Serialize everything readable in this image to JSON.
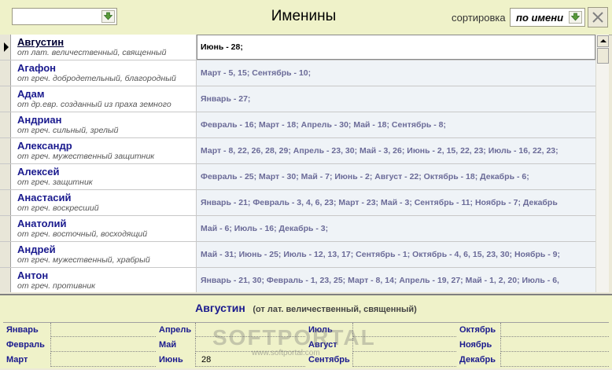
{
  "header": {
    "search_value": "",
    "title": "Именины",
    "sort_label": "сортировка",
    "sort_value": "по имени"
  },
  "rows": [
    {
      "name": "Августин",
      "origin": "от лат. величественный, священный",
      "dates": "Июнь - 28;",
      "selected": true
    },
    {
      "name": "Агафон",
      "origin": "от греч. добродетельный, благородный",
      "dates": "Март - 5, 15;   Сентябрь - 10;"
    },
    {
      "name": "Адам",
      "origin": "от др.евр. созданный из праха земного",
      "dates": "Январь - 27;"
    },
    {
      "name": "Андриан",
      "origin": "от греч. сильный, зрелый",
      "dates": "Февраль - 16;   Март - 18;   Апрель - 30;   Май - 18;   Сентябрь - 8;"
    },
    {
      "name": "Александр",
      "origin": "от греч. мужественный защитник",
      "dates": "Март - 8, 22, 26, 28, 29;   Апрель - 23, 30;   Май - 3, 26;   Июнь - 2, 15, 22, 23;   Июль - 16, 22, 23;"
    },
    {
      "name": "Алексей",
      "origin": "от греч. защитник",
      "dates": "Февраль - 25;   Март - 30;   Май - 7;   Июнь - 2;   Август - 22;   Октябрь - 18;   Декабрь - 6;"
    },
    {
      "name": "Анастасий",
      "origin": "от греч. воскресший",
      "dates": "Январь - 21;   Февраль - 3, 4, 6, 23;   Март - 23;   Май - 3;   Сентябрь - 11;   Ноябрь - 7;   Декабрь"
    },
    {
      "name": "Анатолий",
      "origin": "от греч. восточный, восходящий",
      "dates": "Май - 6;   Июль - 16;   Декабрь - 3;"
    },
    {
      "name": "Андрей",
      "origin": "от греч. мужественный, храбрый",
      "dates": "Май - 31;   Июнь - 25;   Июль - 12, 13, 17;   Сентябрь - 1;   Октябрь - 4, 6, 15, 23, 30;   Ноябрь - 9;"
    },
    {
      "name": "Антон",
      "origin": "от греч. противник",
      "dates": "Январь - 21, 30;   Февраль - 1, 23, 25;   Март - 8, 14;   Апрель - 19, 27;   Май - 1, 2, 20;   Июль - 6,"
    }
  ],
  "detail": {
    "name": "Августин",
    "origin": "(от лат. величественный, священный)"
  },
  "months": [
    {
      "label": "Январь",
      "value": ""
    },
    {
      "label": "Февраль",
      "value": ""
    },
    {
      "label": "Март",
      "value": ""
    },
    {
      "label": "Апрель",
      "value": ""
    },
    {
      "label": "Май",
      "value": ""
    },
    {
      "label": "Июнь",
      "value": "28"
    },
    {
      "label": "Июль",
      "value": ""
    },
    {
      "label": "Август",
      "value": ""
    },
    {
      "label": "Сентябрь",
      "value": ""
    },
    {
      "label": "Октябрь",
      "value": ""
    },
    {
      "label": "Ноябрь",
      "value": ""
    },
    {
      "label": "Декабрь",
      "value": ""
    }
  ],
  "watermark": {
    "logo": "SOFTPORTAL",
    "url": "www.softportal.com"
  },
  "colors": {
    "accent": "#1a1a8e",
    "dates": "#6b6b98",
    "panel": "#eff2c9",
    "drop_icon": "#5a9a3a"
  }
}
